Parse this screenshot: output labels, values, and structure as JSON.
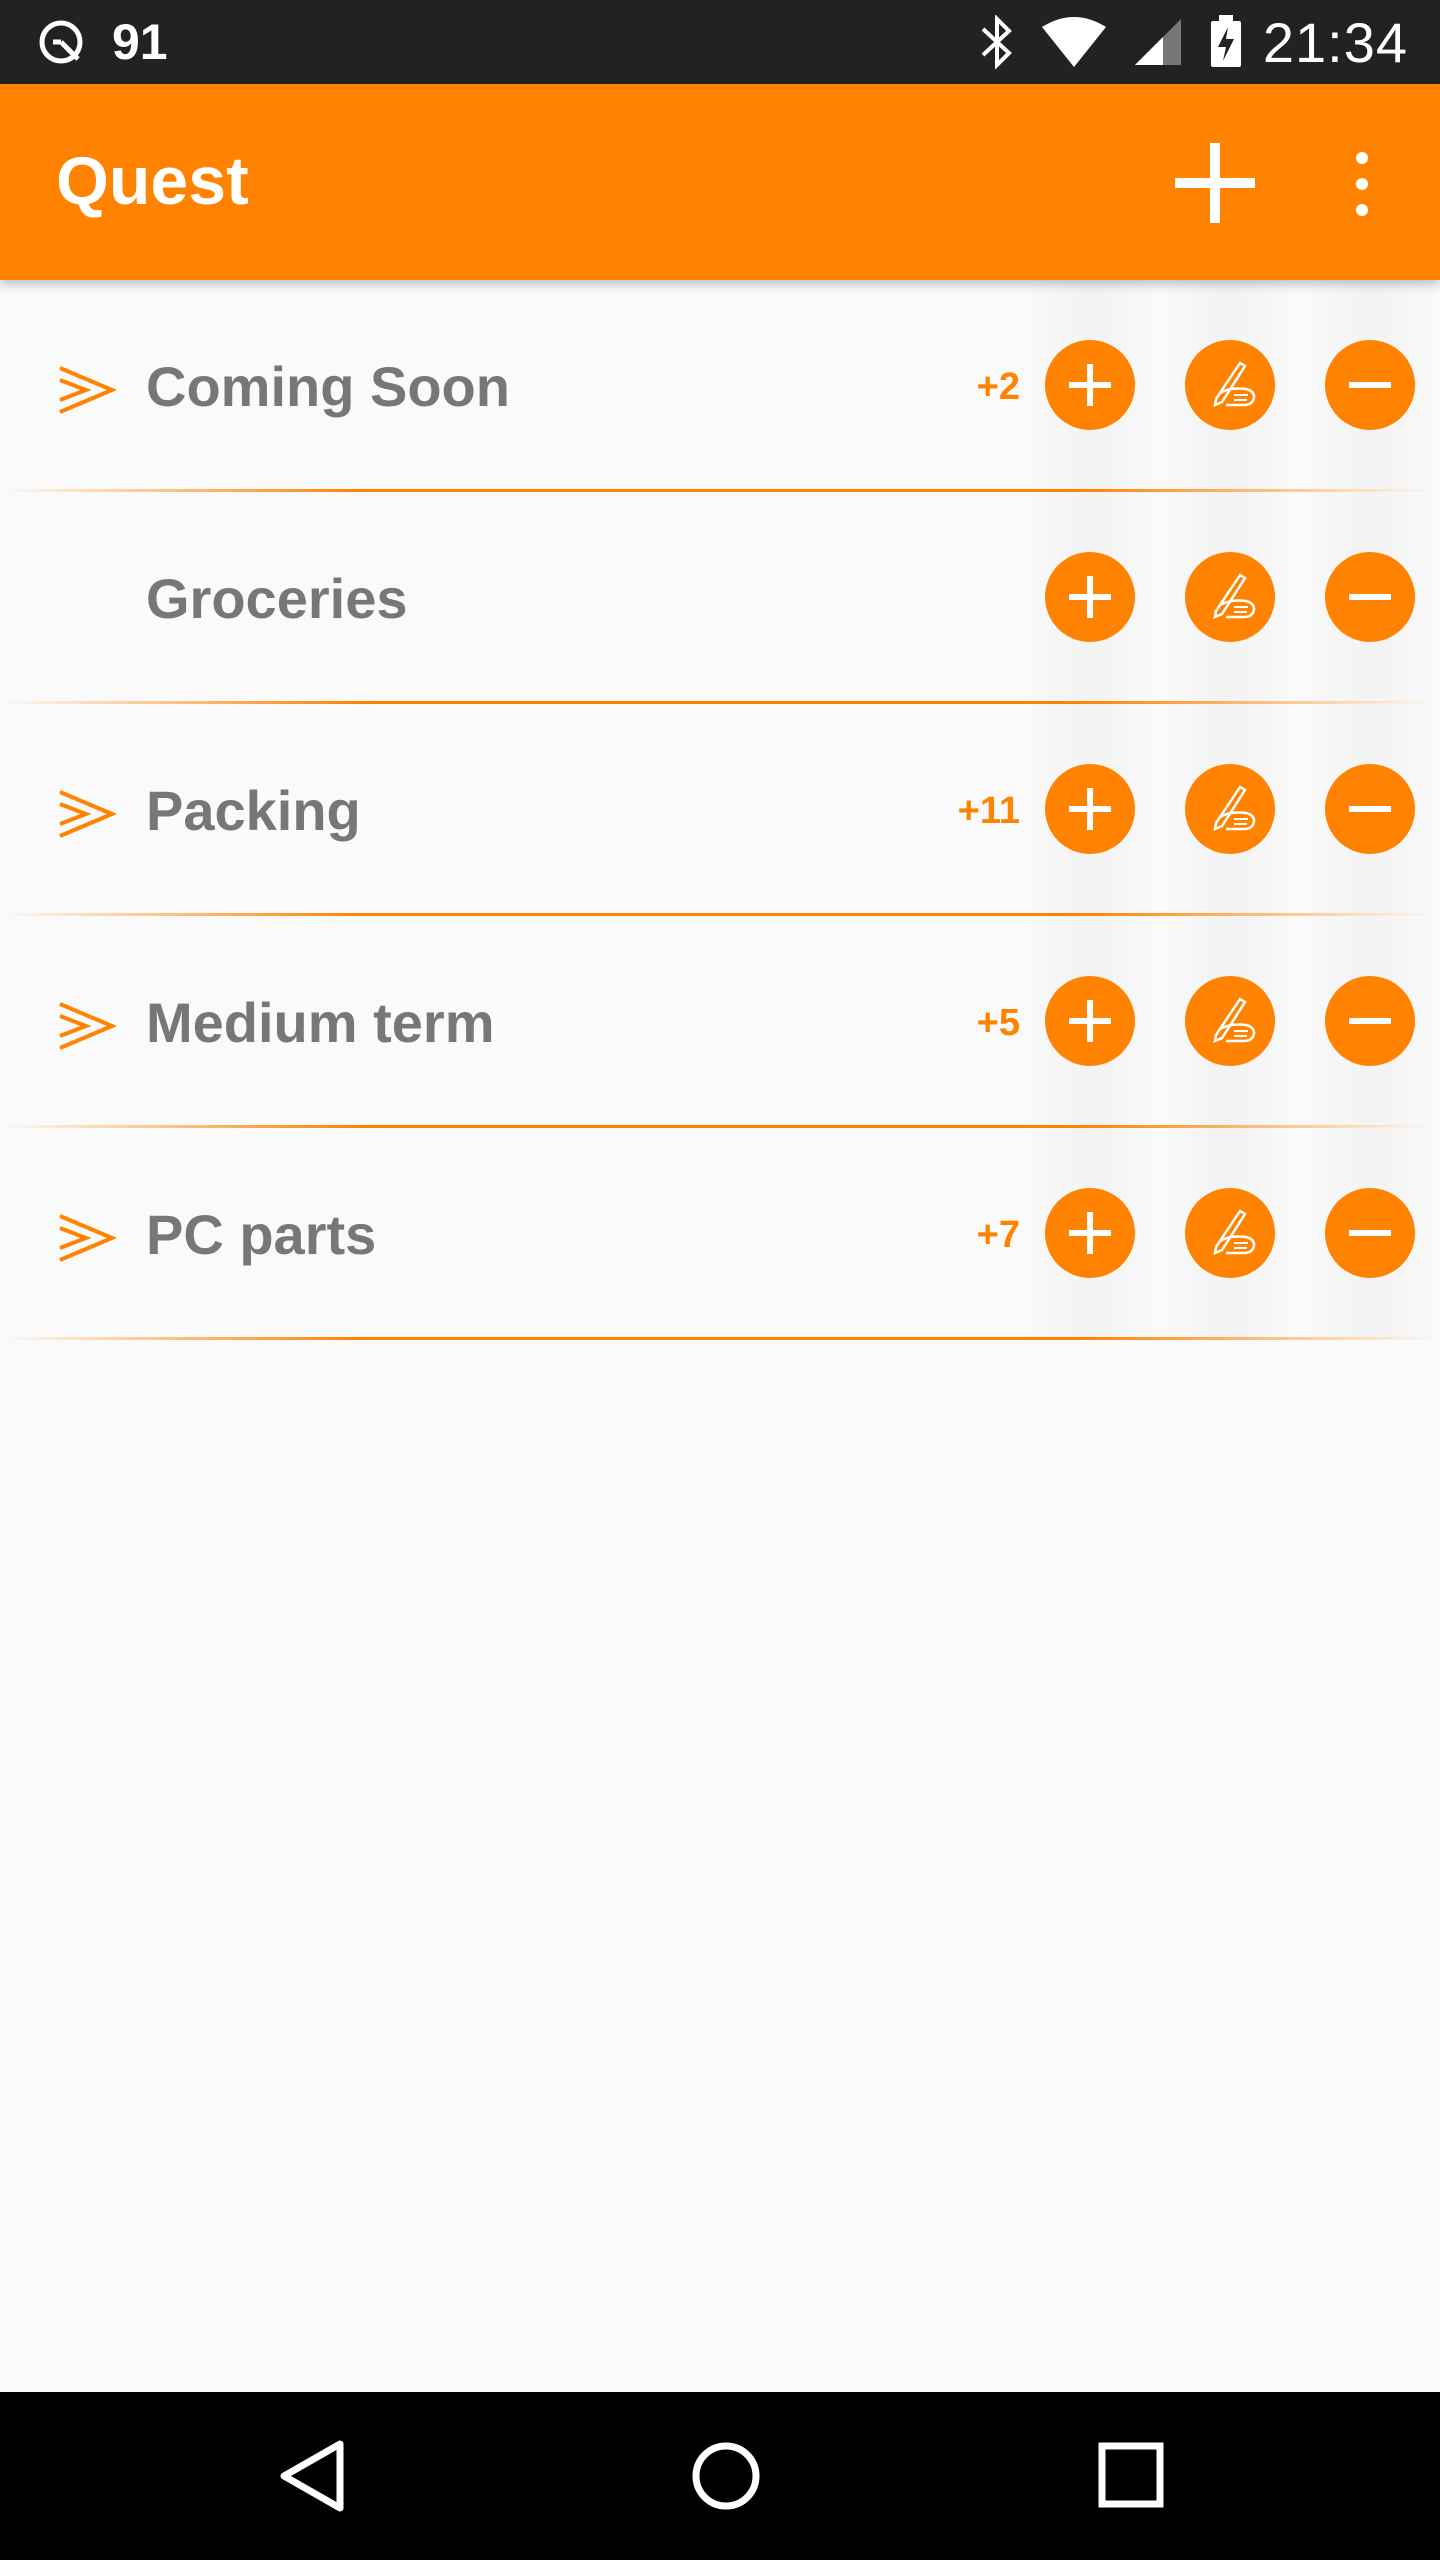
{
  "status_bar": {
    "notification_count": "91",
    "time": "21:34"
  },
  "app_bar": {
    "title": "Quest",
    "add_icon": "plus-icon",
    "menu_icon": "overflow-menu-icon"
  },
  "lists": [
    {
      "label": "Coming Soon",
      "count": "+2",
      "has_children": true
    },
    {
      "label": "Groceries",
      "count": "",
      "has_children": false
    },
    {
      "label": "Packing",
      "count": "+11",
      "has_children": true
    },
    {
      "label": "Medium term",
      "count": "+5",
      "has_children": true
    },
    {
      "label": "PC parts",
      "count": "+7",
      "has_children": true
    }
  ],
  "row_actions": {
    "add_icon": "plus-icon",
    "edit_icon": "hand-writing-icon",
    "remove_icon": "minus-icon"
  },
  "colors": {
    "accent": "#ff8300",
    "label": "#777777",
    "background": "#fafafa"
  }
}
